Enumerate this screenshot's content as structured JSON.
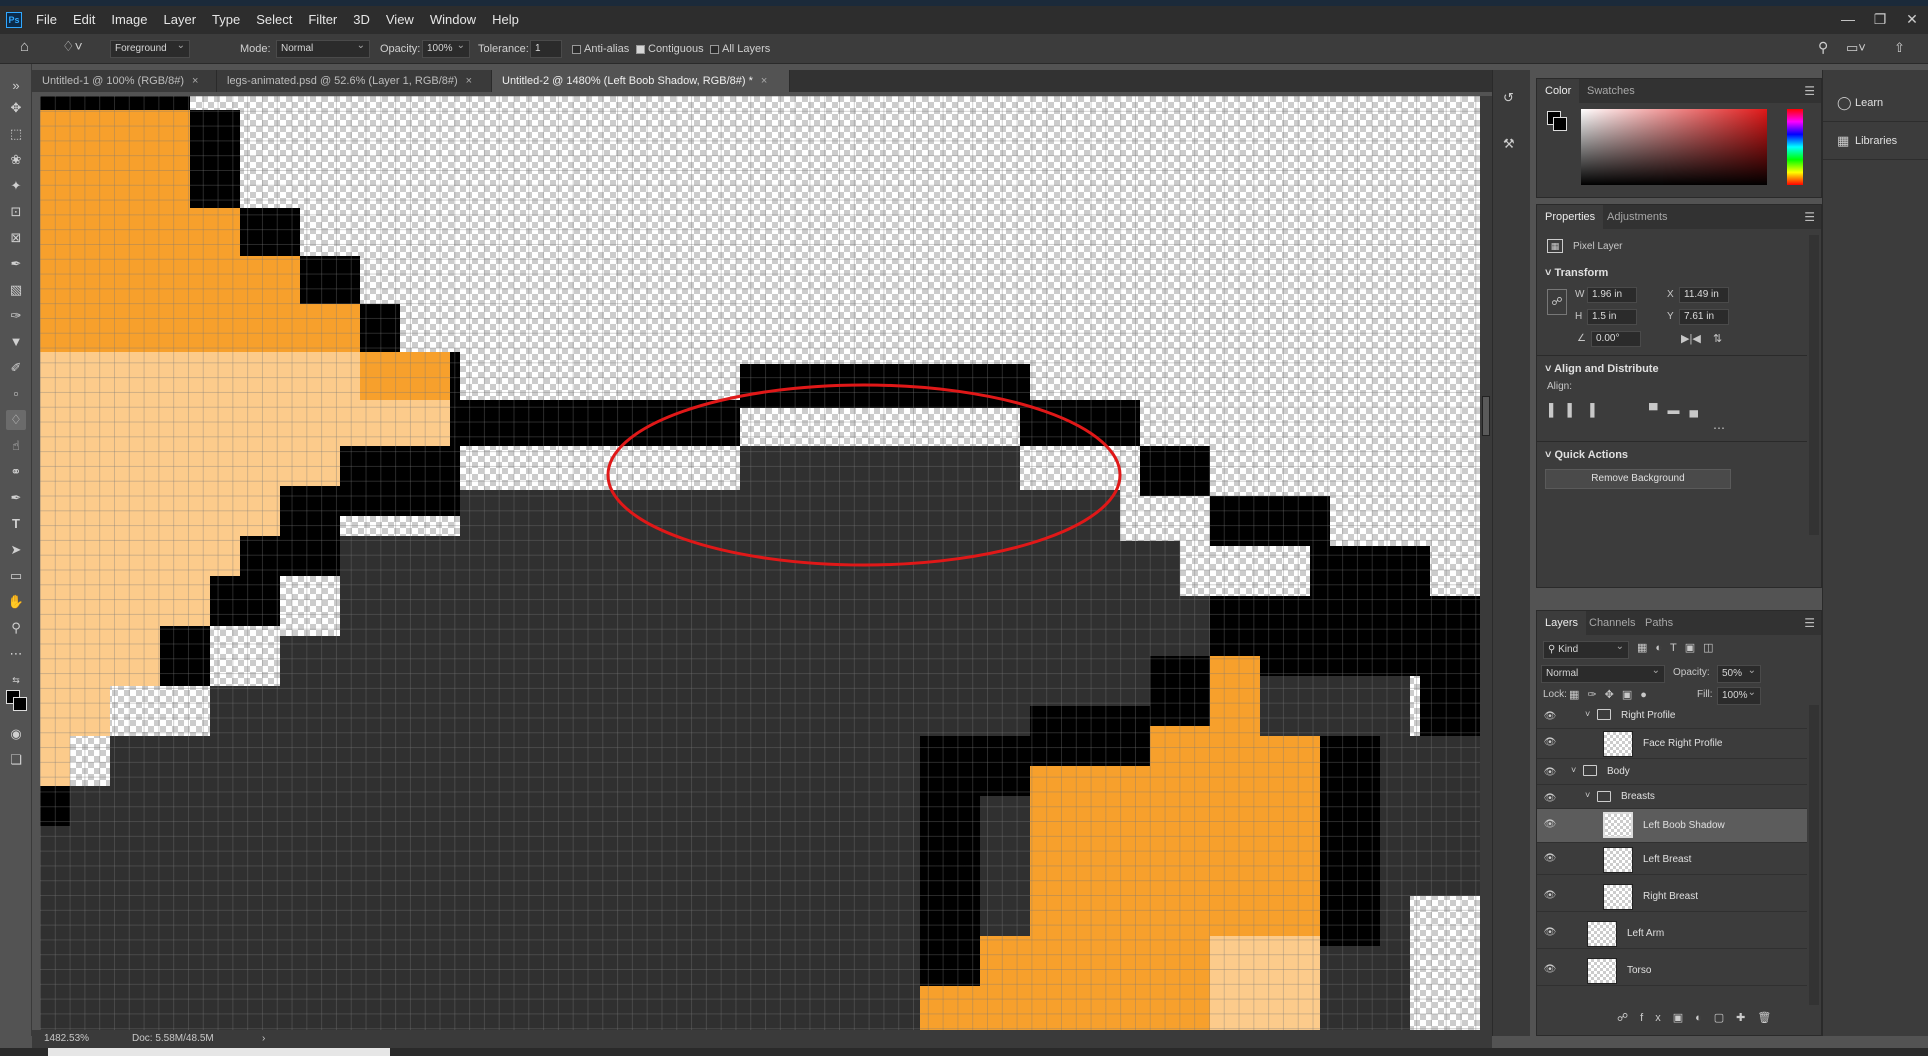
{
  "app": {
    "logo": "Ps"
  },
  "menu": [
    "File",
    "Edit",
    "Image",
    "Layer",
    "Type",
    "Select",
    "Filter",
    "3D",
    "View",
    "Window",
    "Help"
  ],
  "options": {
    "fill_source": "Foreground",
    "mode_label": "Mode:",
    "mode_value": "Normal",
    "opacity_label": "Opacity:",
    "opacity_value": "100%",
    "tolerance_label": "Tolerance:",
    "tolerance_value": "1",
    "anti_alias": "Anti-alias",
    "contiguous": "Contiguous",
    "all_layers": "All Layers"
  },
  "tabs": [
    {
      "label": "Untitled-1 @ 100% (RGB/8#)"
    },
    {
      "label": "legs-animated.psd @ 52.6% (Layer 1, RGB/8#)"
    },
    {
      "label": "Untitled-2 @ 1480% (Left Boob Shadow, RGB/8#) *"
    }
  ],
  "status": {
    "zoom": "1482.53%",
    "doc": "Doc: 5.58M/48.5M"
  },
  "color_panel": {
    "tabs": [
      "Color",
      "Swatches"
    ]
  },
  "properties_panel": {
    "tabs": [
      "Properties",
      "Adjustments"
    ],
    "layer_type": "Pixel Layer",
    "transform_title": "Transform",
    "w_label": "W",
    "w_value": "1.96 in",
    "x_label": "X",
    "x_value": "11.49 in",
    "h_label": "H",
    "h_value": "1.5 in",
    "y_label": "Y",
    "y_value": "7.61 in",
    "angle_value": "0.00°",
    "align_title": "Align and Distribute",
    "align_label": "Align:",
    "quick_title": "Quick Actions",
    "remove_bg": "Remove Background"
  },
  "learn": {
    "items": [
      "Learn",
      "Libraries"
    ]
  },
  "layers_panel": {
    "tabs": [
      "Layers",
      "Channels",
      "Paths"
    ],
    "filter_kind": "Kind",
    "blend_mode": "Normal",
    "opacity_label": "Opacity:",
    "opacity_value": "50%",
    "lock_label": "Lock:",
    "fill_label": "Fill:",
    "fill_value": "100%",
    "layers": [
      {
        "name": "Right Profile",
        "kind": "group"
      },
      {
        "name": "Face Right Profile",
        "kind": "layer"
      },
      {
        "name": "Body",
        "kind": "group"
      },
      {
        "name": "Breasts",
        "kind": "group"
      },
      {
        "name": "Left Boob Shadow",
        "kind": "layer",
        "selected": true
      },
      {
        "name": "Left Breast",
        "kind": "layer"
      },
      {
        "name": "Right Breast",
        "kind": "layer"
      },
      {
        "name": "Left Arm",
        "kind": "layer"
      },
      {
        "name": "Torso",
        "kind": "layer"
      }
    ]
  },
  "colors": {
    "orange": "#f7a02c",
    "light_orange": "#fccb8b",
    "black": "#000000",
    "dark_gray": "#303030",
    "annotation_red": "#e01818"
  }
}
